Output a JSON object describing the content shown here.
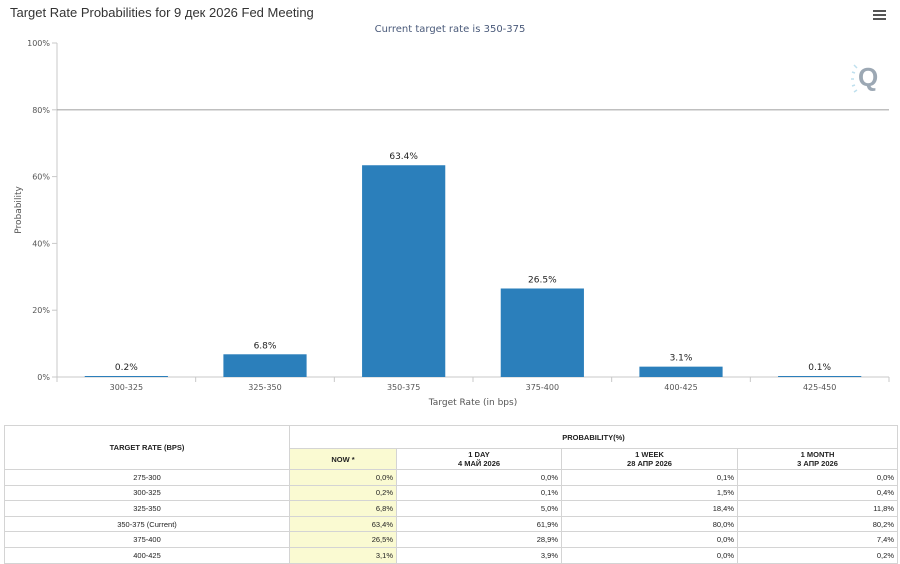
{
  "header": {
    "title": "Target Rate Probabilities for 9 дек 2026 Fed Meeting",
    "subtitle": "Current target rate is 350-375"
  },
  "chart_data": {
    "type": "bar",
    "categories": [
      "300-325",
      "325-350",
      "350-375",
      "375-400",
      "400-425",
      "425-450"
    ],
    "values": [
      0.2,
      6.8,
      63.4,
      26.5,
      3.1,
      0.1
    ],
    "data_labels": [
      "0.2%",
      "6.8%",
      "63.4%",
      "26.5%",
      "3.1%",
      "0.1%"
    ],
    "xlabel": "Target Rate (in bps)",
    "ylabel": "Probability",
    "ylim": [
      0,
      100
    ],
    "yticks": [
      0,
      20,
      40,
      60,
      80,
      100
    ],
    "ytick_labels": [
      "0%",
      "20%",
      "40%",
      "60%",
      "80%",
      "100%"
    ],
    "reference_line": 80,
    "grid": false,
    "bar_color": "#2b7fbb"
  },
  "table": {
    "rate_header": "TARGET RATE (BPS)",
    "prob_header": "PROBABILITY(%)",
    "columns": [
      {
        "line1": "NOW *",
        "line2": ""
      },
      {
        "line1": "1 DAY",
        "line2": "4 МАЙ 2026"
      },
      {
        "line1": "1 WEEK",
        "line2": "28 АПР 2026"
      },
      {
        "line1": "1 MONTH",
        "line2": "3 АПР 2026"
      }
    ],
    "rows": [
      {
        "rate": "275-300",
        "cells": [
          "0,0%",
          "0,0%",
          "0,1%",
          "0,0%"
        ]
      },
      {
        "rate": "300-325",
        "cells": [
          "0,2%",
          "0,1%",
          "1,5%",
          "0,4%"
        ]
      },
      {
        "rate": "325-350",
        "cells": [
          "6,8%",
          "5,0%",
          "18,4%",
          "11,8%"
        ]
      },
      {
        "rate": "350-375 (Current)",
        "cells": [
          "63,4%",
          "61,9%",
          "80,0%",
          "80,2%"
        ]
      },
      {
        "rate": "375-400",
        "cells": [
          "26,5%",
          "28,9%",
          "0,0%",
          "7,4%"
        ]
      },
      {
        "rate": "400-425",
        "cells": [
          "3,1%",
          "3,9%",
          "0,0%",
          "0,2%"
        ]
      }
    ]
  },
  "colors": {
    "bar": "#2b7fbb",
    "now_column": "#fafad2",
    "axis": "#c0c0c0"
  },
  "icons": {
    "menu": "hamburger-menu-icon",
    "logo": "q-logo-icon"
  }
}
